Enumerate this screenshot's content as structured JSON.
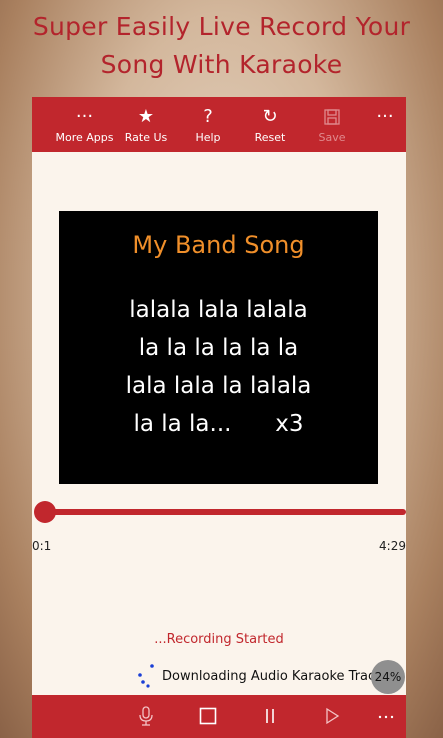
{
  "headline": {
    "line1": "Super Easily Live Record Your",
    "line2": "Song With Karaoke"
  },
  "toolbar": {
    "items": [
      {
        "icon": "ellipsis-icon",
        "glyph": "···",
        "label": "More Apps"
      },
      {
        "icon": "star-icon",
        "glyph": "★",
        "label": "Rate Us"
      },
      {
        "icon": "question-icon",
        "glyph": "?",
        "label": "Help"
      },
      {
        "icon": "reset-icon",
        "glyph": "↻",
        "label": "Reset"
      },
      {
        "icon": "save-icon",
        "glyph": "",
        "label": "Save",
        "disabled": true
      }
    ],
    "more_glyph": "···"
  },
  "lyrics": {
    "title": "My Band Song",
    "lines": [
      "lalala lala lalala",
      "la la la la la la",
      "lala lala la lalala",
      "la la la...      x3"
    ]
  },
  "player": {
    "progress_fraction": 0.0,
    "time_current": "0:1",
    "time_total": "4:29"
  },
  "status": {
    "recording": "...Recording Started",
    "download_text": "Downloading Audio Karaoke Track",
    "download_percent": "24%"
  },
  "colors": {
    "accent": "#c1272d",
    "title_orange": "#f08f2a",
    "panel_bg": "#fbf4ec"
  }
}
